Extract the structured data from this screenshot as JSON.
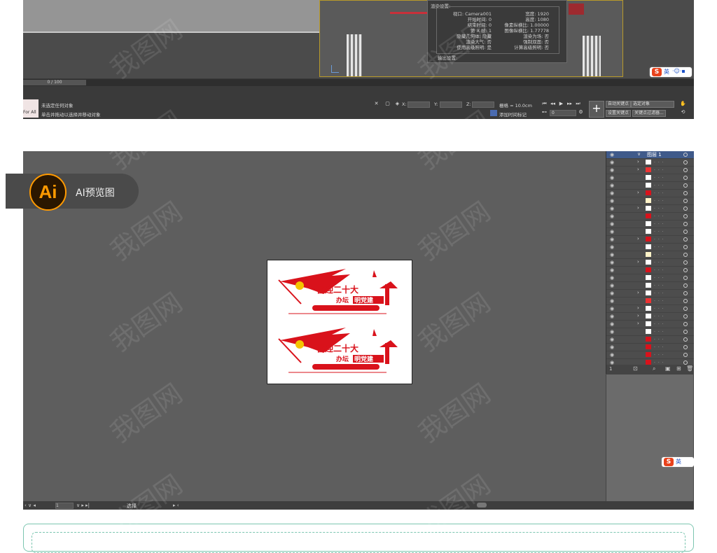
{
  "max": {
    "render_dialog": {
      "title": "渲染设置:",
      "left_rows": [
        "视口: Camera001",
        "开始时间: 0",
        "结束时间: 0",
        "第 X 帧: 1",
        "隐藏几何体: 隐藏",
        "渲染大气: 否",
        "使用高级照明: 是"
      ],
      "right_rows": [
        "宽度: 1920",
        "高度: 1080",
        "像素纵横比: 1.00000",
        "图像纵横比: 1.77778",
        "渲染为场: 否",
        "强制双面: 否",
        "计算高级照明: 否"
      ],
      "output": "输出设置:"
    },
    "timeline": {
      "frame": "0 / 100"
    },
    "status": {
      "left_tag": "For All",
      "line1": "未选定任何对象",
      "line2": "单击并拖动以选择并移动对象",
      "x_label": "X:",
      "y_label": "Y:",
      "z_label": "Z:",
      "grid": "栅格 = 10.0cm",
      "add_time_tag": "添加时间标记",
      "frame_value": "0",
      "auto_key": "自动关键点",
      "select_obj": "选定对象",
      "set_key": "设置关键点",
      "key_filter": "关键点过滤器..."
    }
  },
  "ai": {
    "badge_logo": "Ai",
    "badge_label": "AI预览图",
    "layers": {
      "top_layer": "图层 1"
    },
    "status": {
      "zoom": "1",
      "tool": "选择"
    }
  },
  "ime": {
    "logo": "S",
    "text": "英"
  },
  "artwork": {
    "headline": "喜迎二十大",
    "sub_prefix": "办坛",
    "sub_boxed": "明党建"
  },
  "watermark": "我图网",
  "colors": {
    "accent_red": "#d9121b",
    "ai_orange": "#ff9a00"
  }
}
